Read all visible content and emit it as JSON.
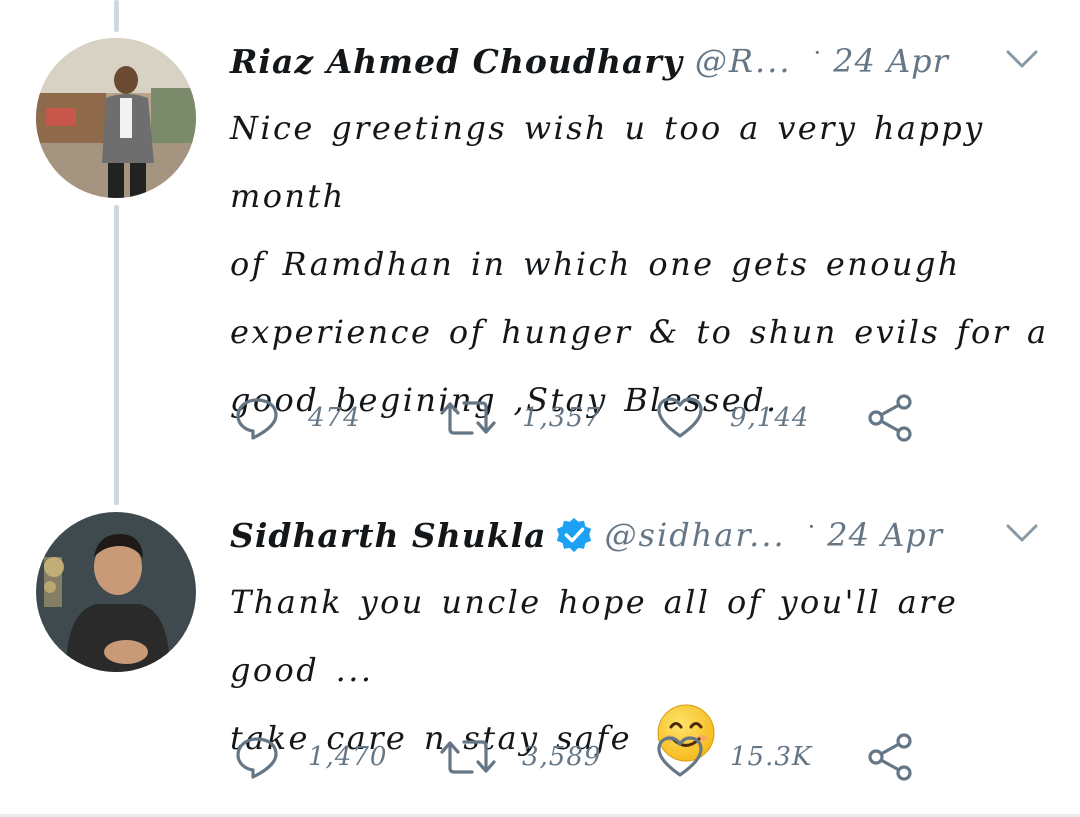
{
  "tweets": [
    {
      "name": "Riaz Ahmed Choudhary",
      "handle": "@R...",
      "separator": "·",
      "date": "24 Apr",
      "verified": false,
      "text_lines": [
        "Nice greetings wish u too a very happy month",
        "of Ramdhan in which one gets enough",
        "experience of hunger & to shun evils for a",
        "good begining ,Stay Blessed."
      ],
      "replies": "474",
      "retweets": "1,357",
      "likes": "9,144"
    },
    {
      "name": "Sidharth Shukla",
      "handle": "@sidhar...",
      "separator": "·",
      "date": "24 Apr",
      "verified": true,
      "text_lines": [
        "Thank you uncle hope all of you'll are good ...",
        "take care n stay safe"
      ],
      "emoji": "smiling-face-emoji",
      "replies": "1,470",
      "retweets": "3,589",
      "likes": "15.3K"
    }
  ],
  "colors": {
    "text": "#14171a",
    "muted": "#657786",
    "verified": "#1da1f2",
    "thread_line": "#cfd9de"
  }
}
